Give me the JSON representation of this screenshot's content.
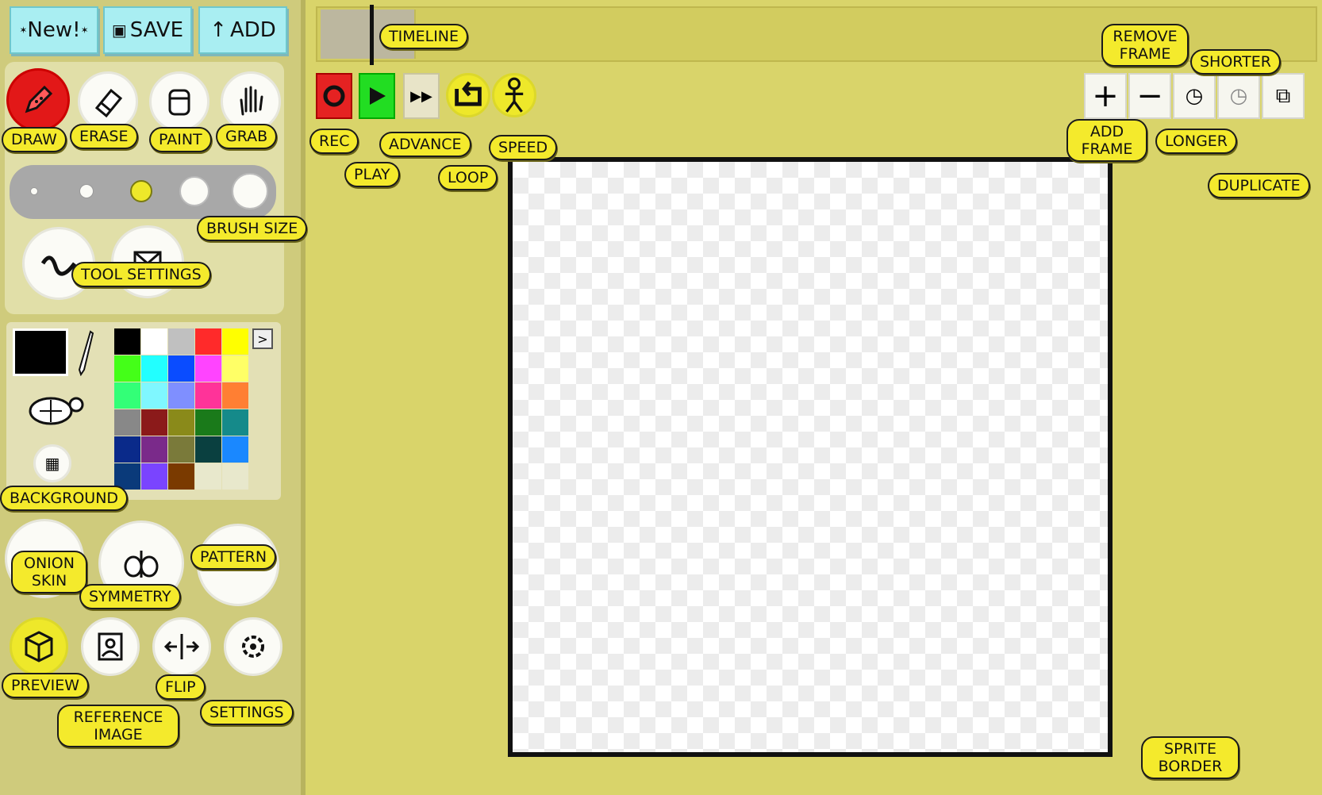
{
  "toolbar": {
    "new_label": "New!",
    "save_label": "SAVE",
    "add_label": "ADD"
  },
  "tools": {
    "draw": "DRAW",
    "erase": "ERASE",
    "paint": "PAINT",
    "grab": "GRAB"
  },
  "brush": {
    "label": "BRUSH SIZE",
    "selected_index": 2
  },
  "tool_settings": {
    "label": "TOOL SETTINGS"
  },
  "palette": {
    "current_color": "#000000",
    "more_label": ">",
    "background_label": "BACKGROUND",
    "colors": [
      "#000000",
      "#ffffff",
      "#c0c0c0",
      "#ff2a2a",
      "#ffff00",
      "#44ff18",
      "#22ffff",
      "#0a4cff",
      "#ff44ff",
      "#ffff66",
      "#33ff77",
      "#7ff7ff",
      "#7f8fff",
      "#ff3399",
      "#ff7f33",
      "#888888",
      "#8b1a1a",
      "#8a8a1a",
      "#1a7a1a",
      "#158a8a",
      "#0a2a8a",
      "#7a2a8a",
      "#7a7a3a",
      "#0a4040",
      "#1a88ff",
      "#0a3a7a",
      "#7a44ff",
      "#7a3a00",
      "#e8e8cc",
      "#e8e8cc"
    ]
  },
  "view_tools": {
    "onion_skin": "ONION SKIN",
    "symmetry": "SYMMETRY",
    "pattern": "PATTERN"
  },
  "bottom_tools": {
    "preview": "PREVIEW",
    "reference_image": "REFERENCE IMAGE",
    "flip": "FLIP",
    "settings": "SETTINGS"
  },
  "timeline": {
    "label": "TIMELINE"
  },
  "playback": {
    "rec": "REC",
    "play": "PLAY",
    "advance": "ADVANCE",
    "loop": "LOOP",
    "speed": "SPEED"
  },
  "frames": {
    "remove": "REMOVE FRAME",
    "shorter": "SHORTER",
    "add": "ADD FRAME",
    "longer": "LONGER",
    "duplicate": "DUPLICATE"
  },
  "canvas": {
    "sprite_border": "SPRITE BORDER"
  }
}
